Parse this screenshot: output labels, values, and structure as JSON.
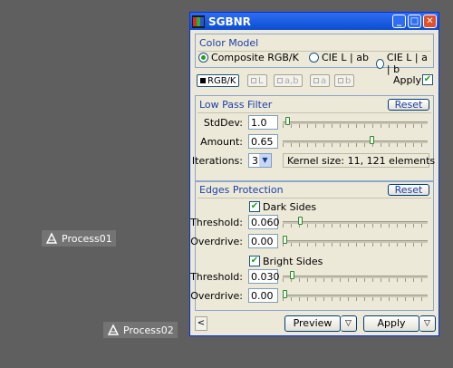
{
  "desktop": {
    "icons": [
      {
        "label": "Process01"
      },
      {
        "label": "Process02"
      }
    ]
  },
  "window": {
    "title": "SGBNR"
  },
  "color_model": {
    "heading": "Color Model",
    "options": [
      {
        "label": "Composite RGB/K",
        "selected": true
      },
      {
        "label": "CIE L | ab",
        "selected": false
      },
      {
        "label": "CIE L | a | b",
        "selected": false
      }
    ]
  },
  "channels": {
    "buttons": [
      {
        "label": "RGB/K",
        "enabled": true
      },
      {
        "label": "L",
        "enabled": false
      },
      {
        "label": "a,b",
        "enabled": false
      },
      {
        "label": "a",
        "enabled": false
      },
      {
        "label": "b",
        "enabled": false
      }
    ],
    "apply_label": "Apply",
    "apply_checked": true
  },
  "low_pass": {
    "heading": "Low Pass Filter",
    "reset_label": "Reset",
    "stddev_label": "StdDev:",
    "stddev_value": "1.0",
    "stddev_slider_fraction": 0.02,
    "amount_label": "Amount:",
    "amount_value": "0.65",
    "amount_slider_fraction": 0.62,
    "iterations_label": "Iterations:",
    "iterations_value": "3",
    "kernel_info": "Kernel size: 11, 121 elements"
  },
  "edges": {
    "heading": "Edges Protection",
    "reset_label": "Reset",
    "dark_label": "Dark Sides",
    "dark_checked": true,
    "dark_threshold_label": "Threshold:",
    "dark_threshold_value": "0.060",
    "dark_threshold_fraction": 0.11,
    "dark_overdrive_label": "Overdrive:",
    "dark_overdrive_value": "0.00",
    "dark_overdrive_fraction": 0.0,
    "bright_label": "Bright Sides",
    "bright_checked": true,
    "bright_threshold_label": "Threshold:",
    "bright_threshold_value": "0.030",
    "bright_threshold_fraction": 0.05,
    "bright_overdrive_label": "Overdrive:",
    "bright_overdrive_value": "0.00",
    "bright_overdrive_fraction": 0.0
  },
  "footer": {
    "scroll_glyph": "<",
    "preview_label": "Preview",
    "apply_label": "Apply",
    "dropdown_glyph": "▽"
  },
  "colors": {
    "accent": "#0a4ed4",
    "section_title": "#1c3fa8",
    "check": "#21a121"
  },
  "icons": {
    "app": "pixinsight-app-icon",
    "process": "process-icon"
  }
}
